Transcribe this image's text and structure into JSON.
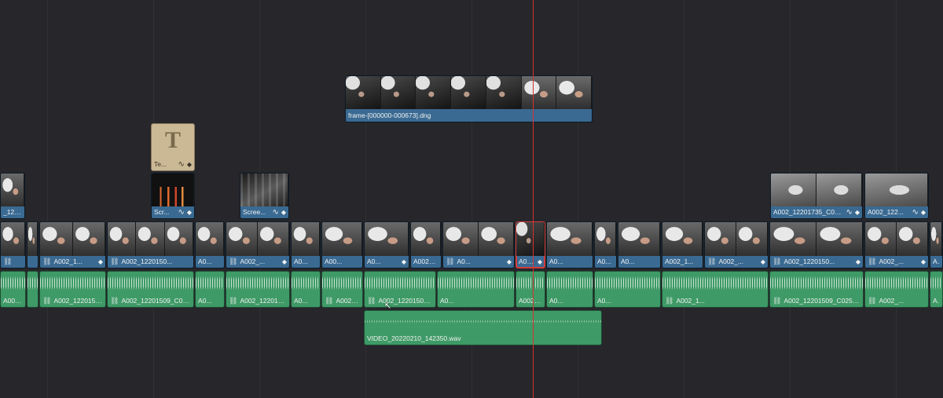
{
  "colors": {
    "background": "#26262b",
    "video_clip": "#3a6a92",
    "audio_clip": "#3e9a66",
    "title_clip": "#cbb895",
    "playhead": "#d8322f",
    "selection": "#d23c3c"
  },
  "icons": {
    "link": "link-icon",
    "fx": "fx-curve-icon",
    "keyframe": "keyframe-diamond-icon"
  },
  "tracks": {
    "v4_clips": [
      {
        "name": "frame-[000000-000673].dng"
      }
    ],
    "v3_clips": [
      {
        "name": "Te...",
        "glyph": "T"
      }
    ],
    "v2_clips": [
      {
        "name": "_12201..."
      },
      {
        "name": "Scr..."
      },
      {
        "name": "Scree..."
      },
      {
        "name": "A002_12201735_C03..."
      },
      {
        "name": "A002_122..."
      }
    ],
    "v1_clips": [
      {
        "name": ""
      },
      {
        "name": ""
      },
      {
        "name": "A002_1..."
      },
      {
        "name": "A002_1220150..."
      },
      {
        "name": "A0..."
      },
      {
        "name": "A002_..."
      },
      {
        "name": "A0..."
      },
      {
        "name": "A00..."
      },
      {
        "name": "A0..."
      },
      {
        "name": "A002_12..."
      },
      {
        "name": "A0..."
      },
      {
        "name": "A00..."
      },
      {
        "name": "A0..."
      },
      {
        "name": "A0..."
      },
      {
        "name": "A0..."
      },
      {
        "name": "A002_1..."
      },
      {
        "name": "A002_..."
      },
      {
        "name": "A002_1220150..."
      },
      {
        "name": "A002_..."
      },
      {
        "name": "A0..."
      }
    ],
    "a1_clips": [
      {
        "name": "A002_1..."
      },
      {
        "name": ""
      },
      {
        "name": "A002_12201509_..."
      },
      {
        "name": "A002_12201509_C025.b..."
      },
      {
        "name": "A0..."
      },
      {
        "name": "A002_12201509..."
      },
      {
        "name": "A0..."
      },
      {
        "name": "A002_12..."
      },
      {
        "name": "A002_12201509_C..."
      },
      {
        "name": "A0..."
      },
      {
        "name": "A002_1..."
      },
      {
        "name": "A0..."
      },
      {
        "name": "A0..."
      },
      {
        "name": "A002_1..."
      },
      {
        "name": "A002_12201509_C025.braw"
      },
      {
        "name": "A002_..."
      },
      {
        "name": "A0..."
      }
    ],
    "a2_clips": [
      {
        "name": "VIDEO_20220210_142350.wav"
      }
    ]
  }
}
